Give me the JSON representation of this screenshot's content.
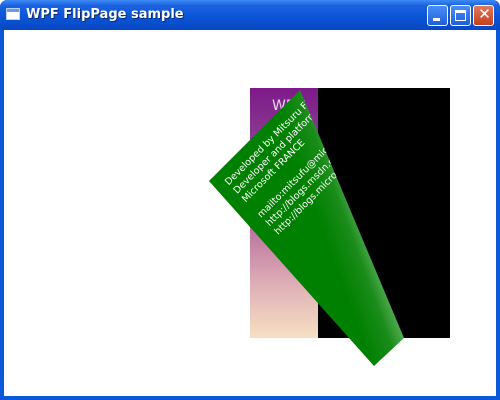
{
  "window": {
    "title": "WPF FlipPage sample",
    "buttons": {
      "minimize": "minimize-icon",
      "maximize": "maximize-icon",
      "close": "close-icon"
    }
  },
  "pages": {
    "back_title": "WP",
    "flipped_lines": [
      "Developed by Mitsuru FURUTA",
      "Developer and platform e",
      "Microsoft FRANCE",
      "mailto:mitsufu@micro",
      "http://blogs.msdn.co",
      "http://blogs.microsoft"
    ]
  },
  "colors": {
    "flip_face": "#008000",
    "next_page": "#000000",
    "back_top": "#7d1a8a",
    "back_bottom": "#f6e0c2"
  }
}
